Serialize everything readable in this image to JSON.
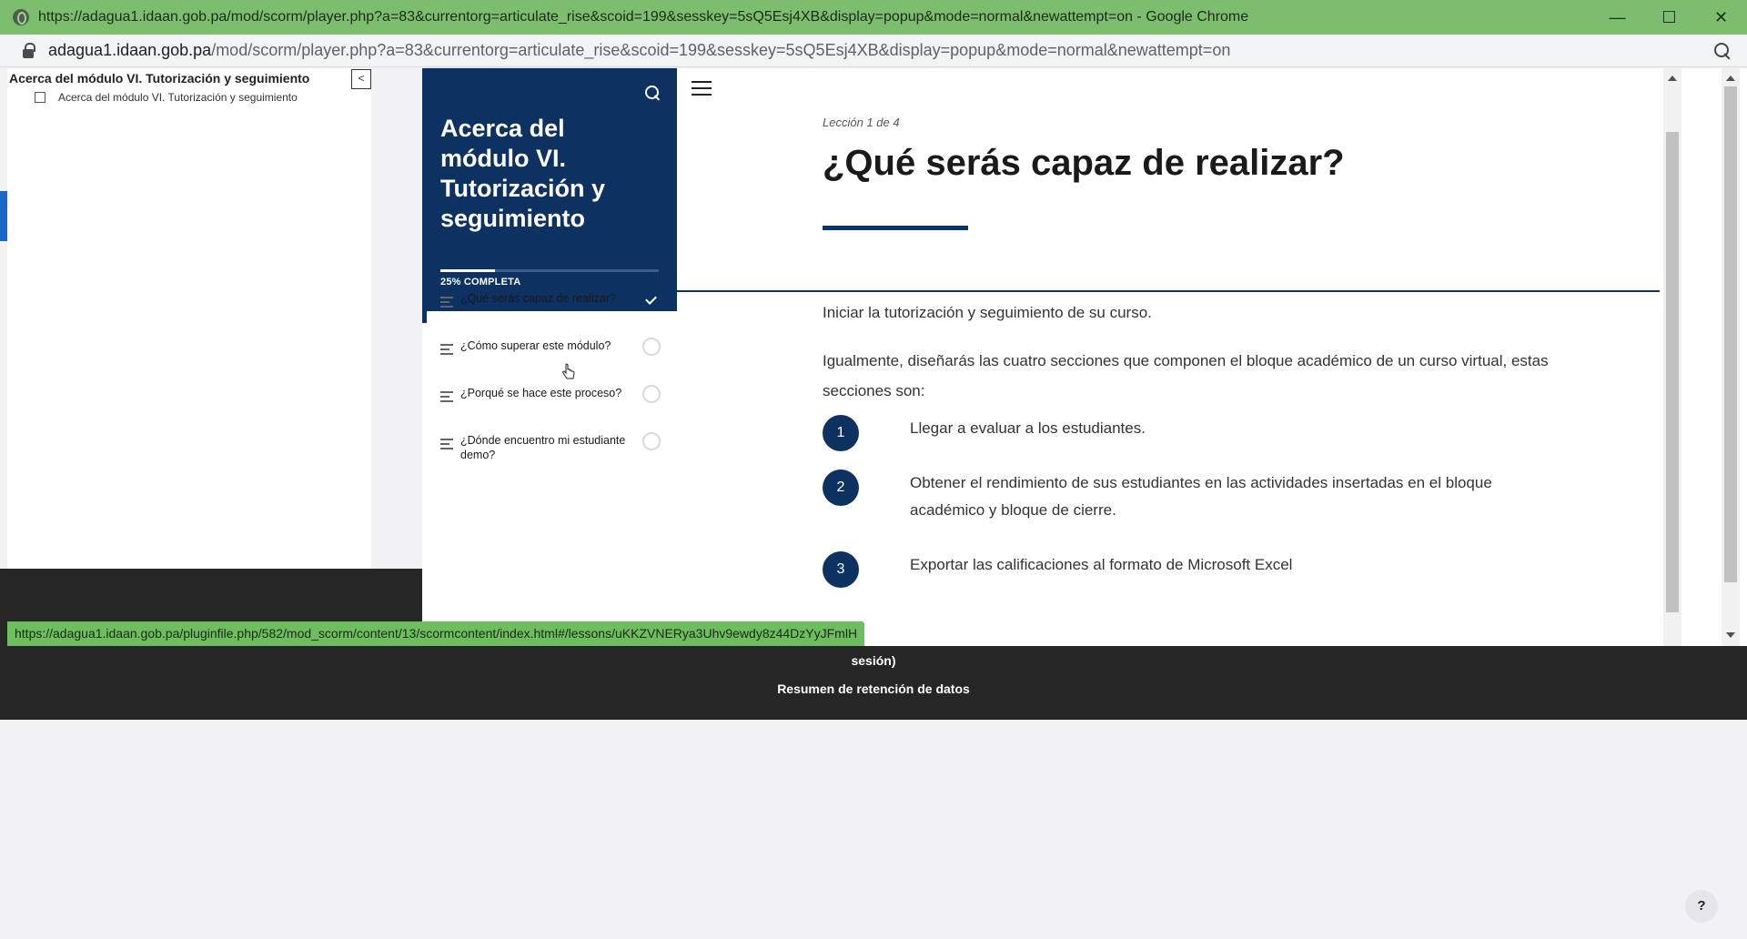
{
  "window": {
    "title": "https://adagua1.idaan.gob.pa/mod/scorm/player.php?a=83&currentorg=articulate_rise&scoid=199&sesskey=5sQ5Esj4XB&display=popup&mode=normal&newattempt=on - Google Chrome",
    "minimize": "—",
    "maximize": "☐",
    "close": "✕"
  },
  "address": {
    "host": "adagua1.idaan.gob.pa",
    "path": "/mod/scorm/player.php?a=83&currentorg=articulate_rise&scoid=199&sesskey=5sQ5Esj4XB&display=popup&mode=normal&newattempt=on"
  },
  "toc": {
    "title": "Acerca del módulo VI. Tutorización y seguimiento",
    "collapse_label": "<",
    "item_label": "Acerca del módulo VI. Tutorización y seguimiento"
  },
  "course": {
    "title": "Acerca del módulo VI. Tutorización y seguimiento",
    "progress_label": "25% COMPLETA",
    "progress": 0.25,
    "lessons": [
      {
        "title": "¿Qué serás capaz de realizar?",
        "done": true
      },
      {
        "title": "¿Cómo superar este módulo?",
        "done": false
      },
      {
        "title": "¿Porqué se hace este proceso?",
        "done": false
      },
      {
        "title": "¿Dónde encuentro mi estudiante demo?",
        "done": false
      }
    ]
  },
  "lesson": {
    "counter": "Lección 1 de 4",
    "title": "¿Qué serás capaz de realizar?",
    "para1": "Iniciar la tutorización y seguimiento de su curso.",
    "para2": "Igualmente, diseñarás las cuatro secciones que componen el bloque académico de un curso virtual, estas secciones son:",
    "items": [
      {
        "num": "1",
        "text": "Llegar a evaluar a los estudiantes."
      },
      {
        "num": "2",
        "text": "Obtener el rendimiento de sus estudiantes en las actividades insertadas en el bloque académico y bloque de cierre."
      },
      {
        "num": "3",
        "text": "Exportar las calificaciones al formato de Microsoft Excel"
      }
    ]
  },
  "footer": {
    "line1": "sesión)",
    "line2": "Resumen de retención de datos"
  },
  "status_url": "https://adagua1.idaan.gob.pa/pluginfile.php/582/mod_scorm/content/13/scormcontent/index.html#/lessons/uKKZVNERya3Uhv9ewdy8z44DzYyJFmlH",
  "help_label": "?",
  "colors": {
    "titlebar": "#7cbd6e",
    "rise_navy": "#0d3161",
    "footer": "#262626"
  }
}
